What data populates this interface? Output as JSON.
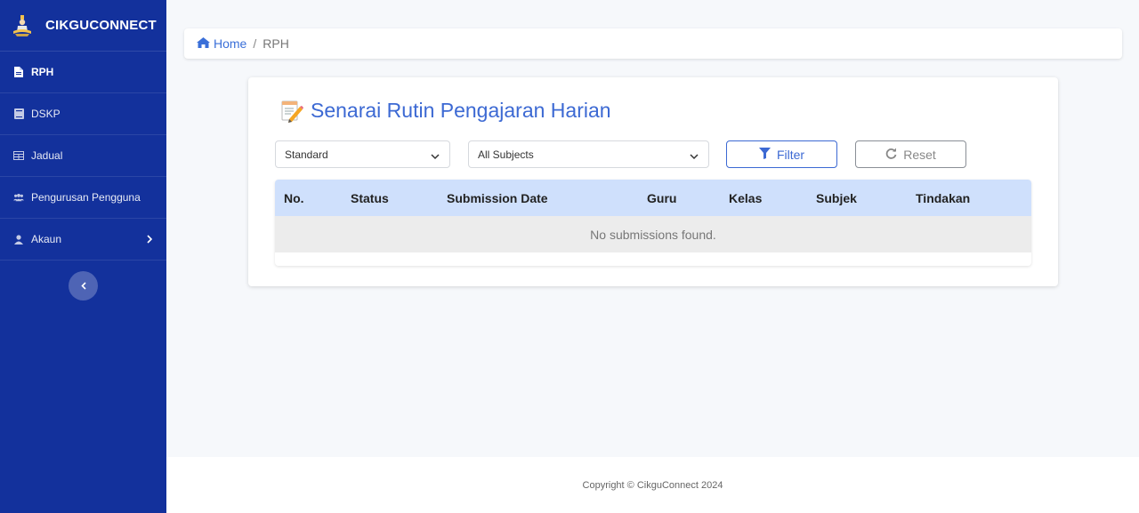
{
  "sidebar": {
    "brand": "CIKGUCONNECT",
    "items": [
      {
        "label": "RPH",
        "icon": "file-icon",
        "active": true
      },
      {
        "label": "DSKP",
        "icon": "book-icon"
      },
      {
        "label": "Jadual",
        "icon": "table-icon"
      },
      {
        "label": "Pengurusan Pengguna",
        "icon": "users-icon"
      },
      {
        "label": "Akaun",
        "icon": "user-icon",
        "has_submenu": true
      }
    ],
    "collapse_icon": "chevron-left-icon"
  },
  "breadcrumb": {
    "home": "Home",
    "separator": "/",
    "current": "RPH"
  },
  "main": {
    "title": "Senarai Rutin Pengajaran Harian",
    "filters": {
      "type_select": "Standard",
      "subject_select": "All Subjects",
      "filter_label": "Filter",
      "reset_label": "Reset"
    },
    "table": {
      "columns": [
        "No.",
        "Status",
        "Submission Date",
        "Guru",
        "Kelas",
        "Subjek",
        "Tindakan"
      ],
      "empty_message": "No submissions found."
    }
  },
  "footer": {
    "copyright": "Copyright © CikguConnect 2024"
  },
  "colors": {
    "sidebar": "#13319c",
    "accent": "#3c69d3",
    "table_header": "#cfe0fc"
  }
}
